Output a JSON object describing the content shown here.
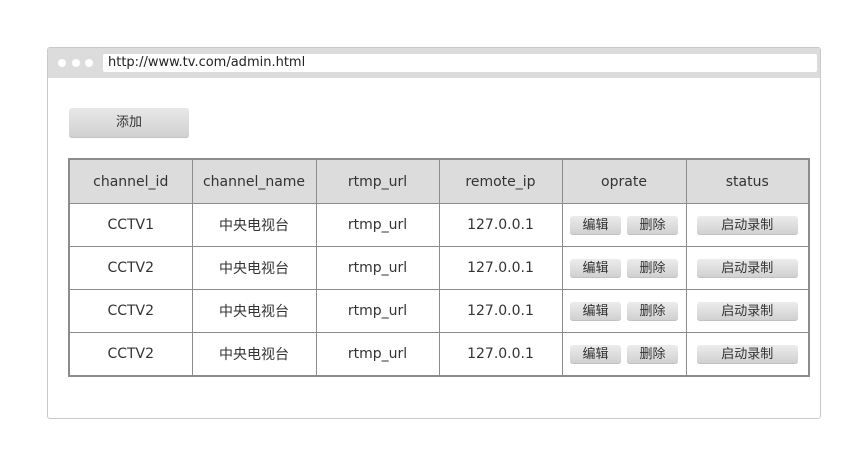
{
  "browser": {
    "url": "http://www.tv.com/admin.html"
  },
  "toolbar": {
    "add_label": "添加"
  },
  "table": {
    "headers": [
      "channel_id",
      "channel_name",
      "rtmp_url",
      "remote_ip",
      "oprate",
      "status"
    ],
    "rows": [
      {
        "channel_id": "CCTV1",
        "channel_name": "中央电视台",
        "rtmp_url": "rtmp_url",
        "remote_ip": "127.0.0.1",
        "edit_label": "编辑",
        "delete_label": "删除",
        "status_label": "启动录制"
      },
      {
        "channel_id": "CCTV2",
        "channel_name": "中央电视台",
        "rtmp_url": "rtmp_url",
        "remote_ip": "127.0.0.1",
        "edit_label": "编辑",
        "delete_label": "删除",
        "status_label": "启动录制"
      },
      {
        "channel_id": "CCTV2",
        "channel_name": "中央电视台",
        "rtmp_url": "rtmp_url",
        "remote_ip": "127.0.0.1",
        "edit_label": "编辑",
        "delete_label": "删除",
        "status_label": "启动录制"
      },
      {
        "channel_id": "CCTV2",
        "channel_name": "中央电视台",
        "rtmp_url": "rtmp_url",
        "remote_ip": "127.0.0.1",
        "edit_label": "编辑",
        "delete_label": "删除",
        "status_label": "启动录制"
      }
    ]
  }
}
